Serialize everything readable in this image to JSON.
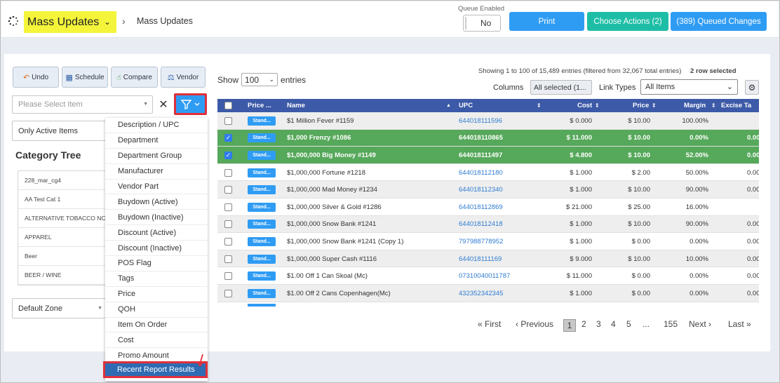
{
  "header": {
    "title": "Mass Updates",
    "breadcrumb": "Mass Updates",
    "queue_label": "Queue Enabled",
    "queue_value": "No",
    "print": "Print",
    "choose_actions": "Choose Actions (2)",
    "queued_changes": "(389) Queued Changes"
  },
  "toolbar": {
    "undo": "Undo",
    "schedule": "Schedule",
    "compare": "Compare",
    "vendor": "Vendor"
  },
  "left": {
    "item_placeholder": "Please Select Item",
    "active_items": "Only Active Items",
    "category_title": "Category Tree",
    "categories": [
      "228_mar_cg4",
      "AA Test Cat 1",
      "ALTERNATIVE TOBACCO NC",
      "APPAREL",
      "Beer",
      "BEER / WINE"
    ],
    "zone": "Default Zone"
  },
  "filter_menu": {
    "items": [
      "Description / UPC",
      "Department",
      "Department Group",
      "Manufacturer",
      "Vendor Part",
      "Buydown (Active)",
      "Buydown (Inactive)",
      "Discount (Active)",
      "Discount (Inactive)",
      "POS Flag",
      "Tags",
      "Price",
      "QOH",
      "Item On Order",
      "Cost",
      "Promo Amount"
    ],
    "highlighted": "Recent Report Results"
  },
  "table_controls": {
    "show": "Show",
    "entries_value": "100",
    "entries": "entries",
    "info": "Showing 1 to 100 of 15,489 entries (filtered from 32,067 total entries)",
    "selected": "2 row selected",
    "columns_label": "Columns",
    "columns_value": "All selected (1...",
    "link_types_label": "Link Types",
    "link_types_value": "All Items"
  },
  "table": {
    "headers": [
      "Price ...",
      "Name",
      "UPC",
      "Cost",
      "Price",
      "Margin",
      "Excise Ta"
    ],
    "rows": [
      {
        "type": "Stand...",
        "name": "$1 Million Fever #1159",
        "upc": "644018111596",
        "cost": "$ 0.000",
        "price": "$ 10.00",
        "margin": "100.00%",
        "excise": "",
        "selected": false
      },
      {
        "type": "Stand...",
        "name": "$1,000 Frenzy #1086",
        "upc": "644018110865",
        "cost": "$ 11.000",
        "price": "$ 10.00",
        "margin": "0.00%",
        "excise": "0.00",
        "selected": true
      },
      {
        "type": "Stand...",
        "name": "$1,000,000 Big Money #1149",
        "upc": "644018111497",
        "cost": "$ 4.800",
        "price": "$ 10.00",
        "margin": "52.00%",
        "excise": "0.00",
        "selected": true
      },
      {
        "type": "Stand...",
        "name": "$1,000,000 Fortune #1218",
        "upc": "644018112180",
        "cost": "$ 1.000",
        "price": "$ 2.00",
        "margin": "50.00%",
        "excise": "0.00",
        "selected": false
      },
      {
        "type": "Stand...",
        "name": "$1,000,000 Mad Money #1234",
        "upc": "644018112340",
        "cost": "$ 1.000",
        "price": "$ 10.00",
        "margin": "90.00%",
        "excise": "0.00",
        "selected": false
      },
      {
        "type": "Stand...",
        "name": "$1,000,000 Silver & Gold #1286",
        "upc": "644018112869",
        "cost": "$ 21.000",
        "price": "$ 25.00",
        "margin": "16.00%",
        "excise": "",
        "selected": false
      },
      {
        "type": "Stand...",
        "name": "$1,000,000 Snow Bank #1241",
        "upc": "644018112418",
        "cost": "$ 1.000",
        "price": "$ 10.00",
        "margin": "90.00%",
        "excise": "0.00",
        "selected": false
      },
      {
        "type": "Stand...",
        "name": "$1,000,000 Snow Bank #1241 (Copy 1)",
        "upc": "797988778952",
        "cost": "$ 1.000",
        "price": "$ 0.00",
        "margin": "0.00%",
        "excise": "0.00",
        "selected": false
      },
      {
        "type": "Stand...",
        "name": "$1,000,000 Super Cash #1116",
        "upc": "644018111169",
        "cost": "$ 9.000",
        "price": "$ 10.00",
        "margin": "10.00%",
        "excise": "0.00",
        "selected": false
      },
      {
        "type": "Stand...",
        "name": "$1.00 Off 1 Can Skoal (Mc)",
        "upc": "07310040011787",
        "cost": "$ 11.000",
        "price": "$ 0.00",
        "margin": "0.00%",
        "excise": "0.00",
        "selected": false
      },
      {
        "type": "Stand...",
        "name": "$1.00 Off 2 Cans Copenhagen(Mc)",
        "upc": "432352342345",
        "cost": "$ 1.000",
        "price": "$ 0.00",
        "margin": "0.00%",
        "excise": "0.00",
        "selected": false
      }
    ]
  },
  "pagination": {
    "first": "« First",
    "previous": "‹ Previous",
    "pages": [
      "1",
      "2",
      "3",
      "4",
      "5",
      "...",
      "155"
    ],
    "next": "Next ›",
    "last": "Last »"
  },
  "colors": {
    "primary": "#2f9cf4",
    "teal": "#1ebea6",
    "header_row": "#3d5aa8",
    "selected_row": "#56a85a",
    "highlight": "#f4f53a",
    "outline_red": "#e0303a"
  }
}
